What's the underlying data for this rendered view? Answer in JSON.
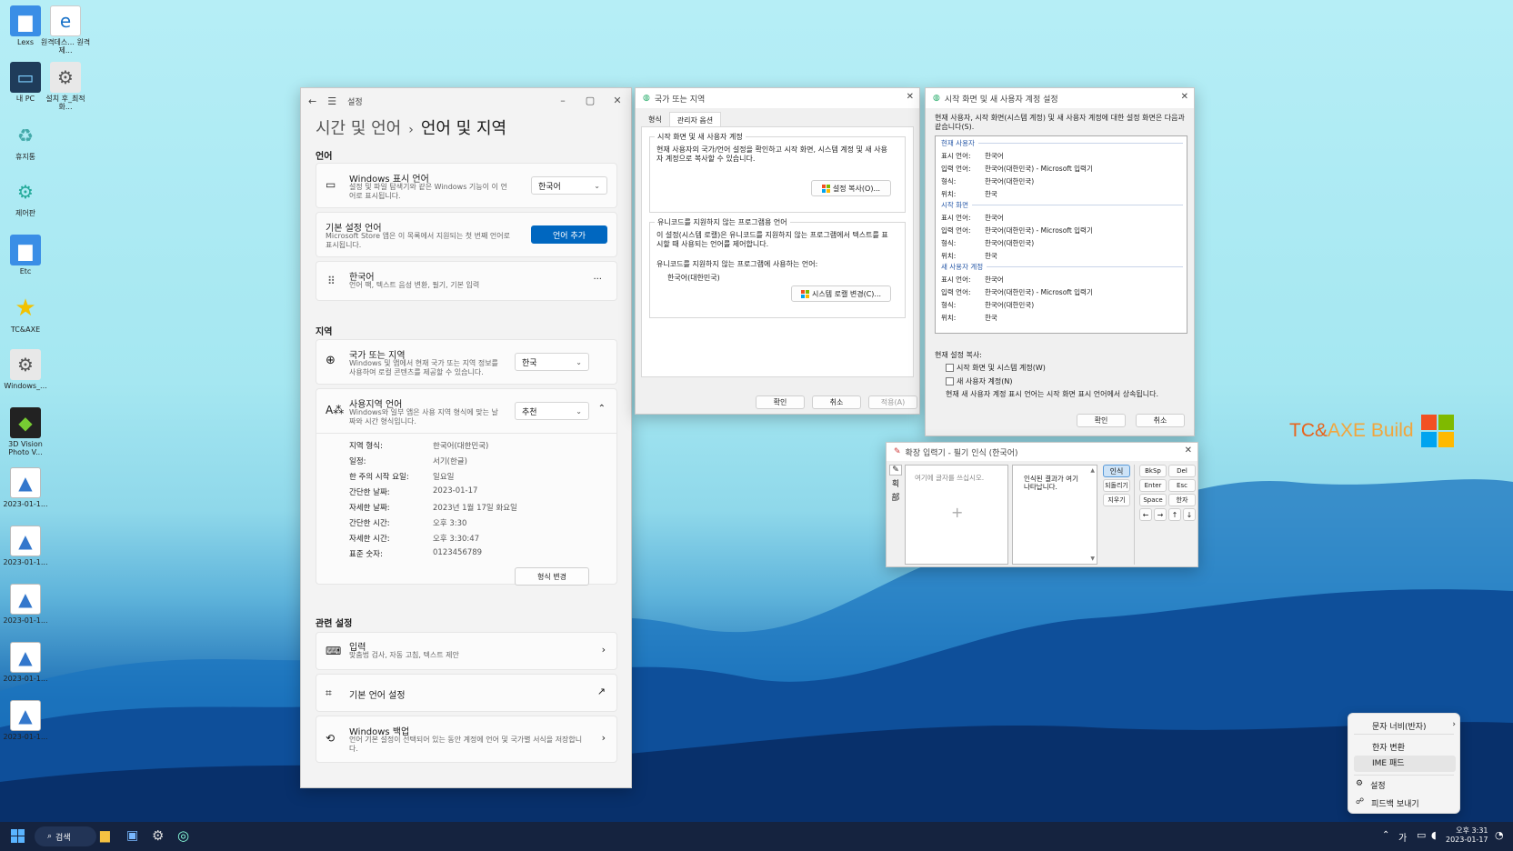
{
  "desktop": {
    "icons": [
      {
        "label": "Lexs"
      },
      {
        "label": "원격데스... 원격제..."
      },
      {
        "label": "내 PC"
      },
      {
        "label": "설치 후_최적화..."
      },
      {
        "label": "휴지통"
      },
      {
        "label": "제어판"
      },
      {
        "label": "Etc"
      },
      {
        "label": "TC&AXE"
      },
      {
        "label": "Windows_..."
      },
      {
        "label": "3D Vision Photo V..."
      },
      {
        "label": "2023-01-1..."
      },
      {
        "label": "2023-01-1..."
      },
      {
        "label": "2023-01-1..."
      },
      {
        "label": "2023-01-1..."
      },
      {
        "label": "2023-01-1..."
      }
    ],
    "brand": {
      "prefix": "TC",
      "amp": "&",
      "rest": "AXE Build"
    },
    "brand_colors": [
      "#f25022",
      "#7fba00",
      "#00a4ef",
      "#ffb900"
    ]
  },
  "settings": {
    "app_title": "설정",
    "breadcrumb_parent": "시간 및 언어",
    "breadcrumb_sep": "›",
    "page_title": "언어 및 지역",
    "section_language": "언어",
    "display_lang_title": "Windows 표시 언어",
    "display_lang_desc": "설정 및 파일 탐색기와 같은 Windows 기능이 이 언어로 표시됩니다.",
    "display_lang_value": "한국어",
    "pref_lang_title": "기본 설정 언어",
    "pref_lang_desc": "Microsoft Store 앱은 이 목록에서 지원되는 첫 번째 언어로 표시됩니다.",
    "add_lang_button": "언어 추가",
    "korean_title": "한국어",
    "korean_desc": "언어 팩, 텍스트 음성 변환, 필기, 기본 입력",
    "more": "···",
    "section_region": "지역",
    "country_title": "국가 또는 지역",
    "country_desc": "Windows 및 앱에서 현재 국가 또는 지역 정보를 사용하여 로컬 콘텐츠를 제공할 수 있습니다.",
    "country_value": "한국",
    "regional_title": "사용지역 언어",
    "regional_desc": "Windows와 일부 앱은 사용 지역 형식에 맞는 날짜와 시간 형식입니다.",
    "regional_value": "추천",
    "formats": [
      {
        "k": "지역 형식:",
        "v": "한국어(대한민국)"
      },
      {
        "k": "일정:",
        "v": "서기(한글)"
      },
      {
        "k": "한 주의 시작 요일:",
        "v": "일요일"
      },
      {
        "k": "간단한 날짜:",
        "v": "2023-01-17"
      },
      {
        "k": "자세한 날짜:",
        "v": "2023년 1월 17일 화요일"
      },
      {
        "k": "간단한 시간:",
        "v": "오후 3:30"
      },
      {
        "k": "자세한 시간:",
        "v": "오후 3:30:47"
      },
      {
        "k": "표준 숫자:",
        "v": "0123456789"
      }
    ],
    "change_format_button": "형식 변경",
    "section_related": "관련 설정",
    "input_title": "입력",
    "input_desc": "맞춤법 검사, 자동 고침, 텍스트 제안",
    "admin_lang_title": "기본 언어 설정",
    "backup_title": "Windows 백업",
    "backup_desc": "언어 기본 설정이 선택되어 있는 동안 계정에 언어 및 국가별 서식을 저장합니다."
  },
  "region_dialog": {
    "title": "국가 또는 지역",
    "tabs": [
      "형식",
      "관리자 옵션"
    ],
    "group1_title": "시작 화면 및 새 사용자 계정",
    "group1_desc": "현재 사용자의 국가/언어 설정을 확인하고 시작 화면, 시스템 계정 및 새 사용자 계정으로 복사할 수 있습니다.",
    "copy_button": "설정 복사(O)...",
    "group2_title": "유니코드를 지원하지 않는 프로그램용 언어",
    "group2_desc": "이 설정(시스템 로캘)은 유니코드를 지원하지 않는 프로그램에서 텍스트를 표시할 때 사용되는 언어를 제어합니다.",
    "current_label": "유니코드를 지원하지 않는 프로그램에 사용하는 언어:",
    "current_value": "한국어(대한민국)",
    "locale_button": "시스템 로캘 변경(C)...",
    "ok": "확인",
    "cancel": "취소",
    "apply": "적용(A)"
  },
  "copy_dialog": {
    "title": "시작 화면 및 새 사용자 계정 설정",
    "intro": "현재 사용자, 시작 화면(시스템 계정) 및 새 사용자 계정에 대한 설정 화면은 다음과 같습니다(S).",
    "sections": [
      {
        "name": "현재 사용자",
        "rows": [
          {
            "k": "표시 언어:",
            "v": "한국어"
          },
          {
            "k": "입력 언어:",
            "v": "한국어(대한민국) - Microsoft 입력기"
          },
          {
            "k": "형식:",
            "v": "한국어(대한민국)"
          },
          {
            "k": "위치:",
            "v": "한국"
          }
        ]
      },
      {
        "name": "시작 화면",
        "rows": [
          {
            "k": "표시 언어:",
            "v": "한국어"
          },
          {
            "k": "입력 언어:",
            "v": "한국어(대한민국) - Microsoft 입력기"
          },
          {
            "k": "형식:",
            "v": "한국어(대한민국)"
          },
          {
            "k": "위치:",
            "v": "한국"
          }
        ]
      },
      {
        "name": "새 사용자 계정",
        "rows": [
          {
            "k": "표시 언어:",
            "v": "한국어"
          },
          {
            "k": "입력 언어:",
            "v": "한국어(대한민국) - Microsoft 입력기"
          },
          {
            "k": "형식:",
            "v": "한국어(대한민국)"
          },
          {
            "k": "위치:",
            "v": "한국"
          }
        ]
      }
    ],
    "copy_label": "현재 설정 복사:",
    "chk1": "시작 화면 및 시스템 계정(W)",
    "chk2": "새 사용자 계정(N)",
    "note": "현재 새 사용자 계정 표시 언어는 시작 화면 표시 언어에서 상속됩니다.",
    "ok": "확인",
    "cancel": "취소"
  },
  "ime_pad": {
    "title": "확장 입력기 - 필기 인식 (한국어)",
    "placeholder": "여기에 글자를 쓰십시오.",
    "result_hint": "인식된 결과가 여기 나타납니다.",
    "btn_recognize": "인식",
    "btn_undo": "되돌리기",
    "btn_clear": "지우기",
    "keys": [
      "BkSp",
      "Del",
      "Enter",
      "Esc",
      "Space",
      "한자"
    ],
    "arrows": [
      "←",
      "→",
      "↑",
      "↓"
    ],
    "side_tabs": [
      "✎",
      "획",
      "部"
    ]
  },
  "ime_menu": {
    "items": [
      "문자 너비(반자)",
      "한자 변환",
      "IME 패드",
      "설정",
      "피드백 보내기"
    ],
    "arrow": "›"
  },
  "taskbar": {
    "search_label": "검색",
    "tray_lang": "가",
    "time": "오후 3:31",
    "date": "2023-01-17"
  }
}
